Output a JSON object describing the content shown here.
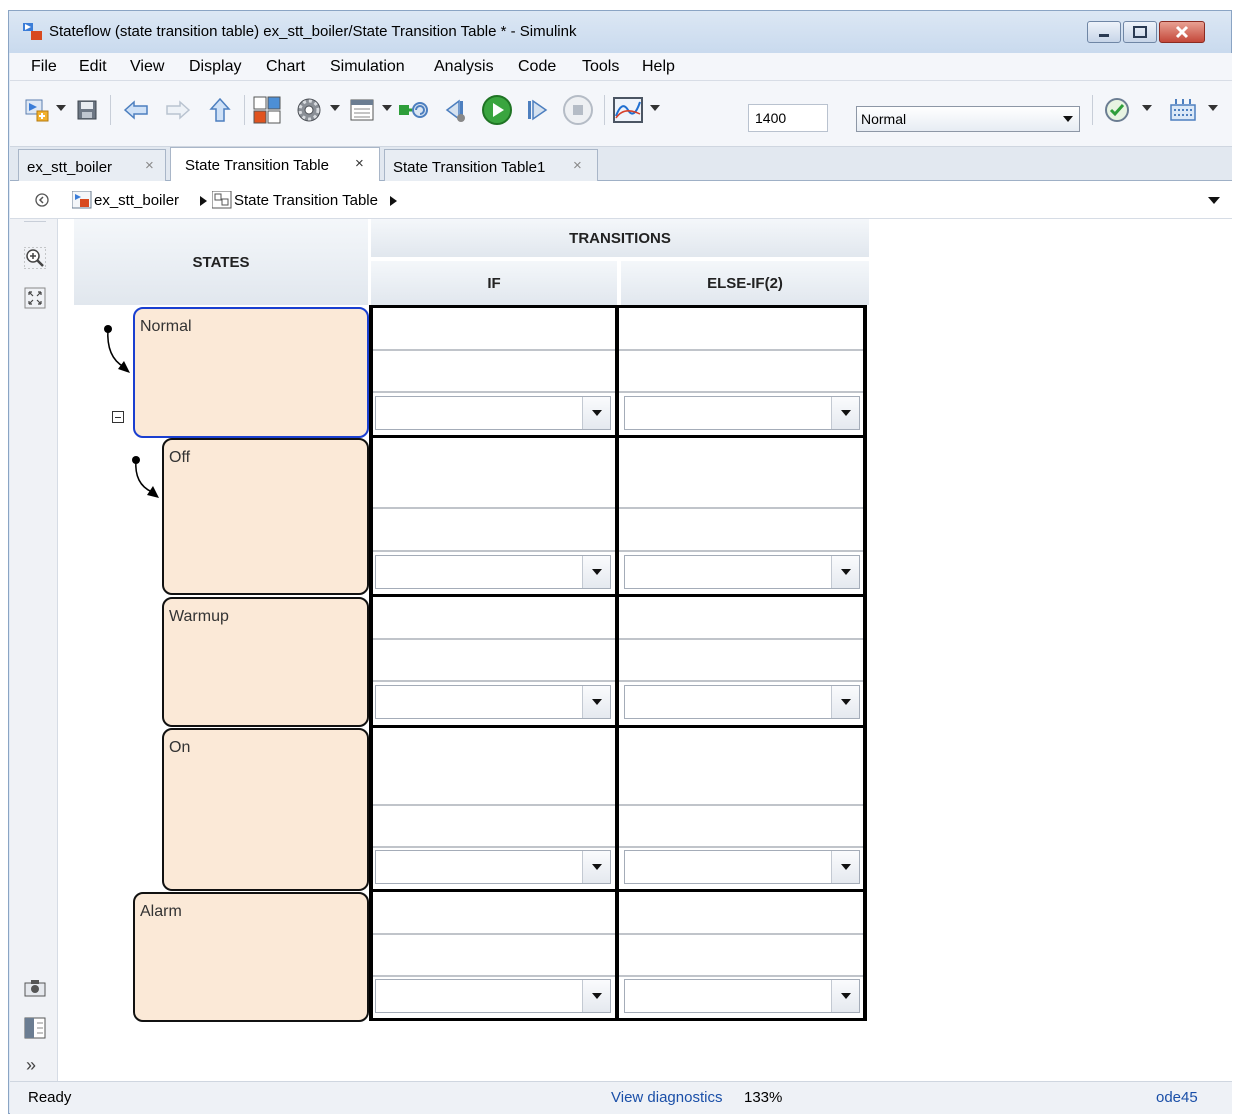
{
  "window": {
    "title": "Stateflow (state transition table) ex_stt_boiler/State Transition Table * - Simulink"
  },
  "menu": [
    "File",
    "Edit",
    "View",
    "Display",
    "Chart",
    "Simulation",
    "Analysis",
    "Code",
    "Tools",
    "Help"
  ],
  "toolbar": {
    "stop_time": "1400",
    "sim_mode": "Normal",
    "icons": [
      "new-model-icon",
      "save-icon",
      "back-icon",
      "forward-icon",
      "up-icon",
      "library-browser-icon",
      "model-config-icon",
      "model-explorer-icon",
      "build-icon",
      "step-back-icon",
      "run-icon",
      "step-forward-icon",
      "stop-icon",
      "scope-icon",
      "check-icon",
      "apps-icon"
    ]
  },
  "tabs": [
    {
      "label": "ex_stt_boiler",
      "close": "×"
    },
    {
      "label": "State Transition Table",
      "close": "×"
    },
    {
      "label": "State Transition Table1",
      "close": "×"
    }
  ],
  "breadcrumb": {
    "items": [
      "ex_stt_boiler",
      "State Transition Table"
    ]
  },
  "table": {
    "header": {
      "states": "STATES",
      "transitions": "TRANSITIONS",
      "if": "IF",
      "elseif": "ELSE-IF(2)"
    },
    "states": [
      "Normal",
      "Off",
      "Warmup",
      "On",
      "Alarm"
    ]
  },
  "status": {
    "left": "Ready",
    "diagnostics": "View diagnostics",
    "zoom": "133%",
    "solver": "ode45"
  },
  "colors": {
    "state_fill": "#fbe9d7",
    "selected_border": "#1a3fd0"
  }
}
